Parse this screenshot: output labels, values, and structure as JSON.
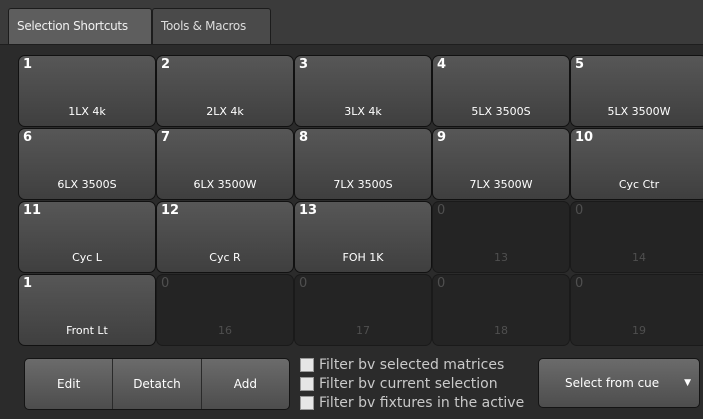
{
  "tabs": [
    {
      "label": "Selection Shortcuts",
      "active": true
    },
    {
      "label": "Tools & Macros",
      "active": false
    }
  ],
  "shortcuts": [
    {
      "number": "1",
      "label": "1LX 4k",
      "empty": false
    },
    {
      "number": "2",
      "label": "2LX 4k",
      "empty": false
    },
    {
      "number": "3",
      "label": "3LX 4k",
      "empty": false
    },
    {
      "number": "4",
      "label": "5LX 3500S",
      "empty": false
    },
    {
      "number": "5",
      "label": "5LX 3500W",
      "empty": false
    },
    {
      "number": "6",
      "label": "6LX 3500S",
      "empty": false
    },
    {
      "number": "7",
      "label": "6LX 3500W",
      "empty": false
    },
    {
      "number": "8",
      "label": "7LX 3500S",
      "empty": false
    },
    {
      "number": "9",
      "label": "7LX 3500W",
      "empty": false
    },
    {
      "number": "10",
      "label": "Cyc Ctr",
      "empty": false
    },
    {
      "number": "11",
      "label": "Cyc L",
      "empty": false
    },
    {
      "number": "12",
      "label": "Cyc R",
      "empty": false
    },
    {
      "number": "13",
      "label": "FOH 1K",
      "empty": false
    },
    {
      "number": "0",
      "label": "13",
      "empty": true
    },
    {
      "number": "0",
      "label": "14",
      "empty": true
    },
    {
      "number": "1",
      "label": "Front Lt",
      "empty": false
    },
    {
      "number": "0",
      "label": "16",
      "empty": true
    },
    {
      "number": "0",
      "label": "17",
      "empty": true
    },
    {
      "number": "0",
      "label": "18",
      "empty": true
    },
    {
      "number": "0",
      "label": "19",
      "empty": true
    }
  ],
  "buttons": {
    "edit": "Edit",
    "detatch": "Detatch",
    "add": "Add"
  },
  "filters": [
    "Filter bv selected matrices",
    "Filter bv current selection",
    "Filter bv fixtures in the active"
  ],
  "select_from_cue": "Select from cue"
}
